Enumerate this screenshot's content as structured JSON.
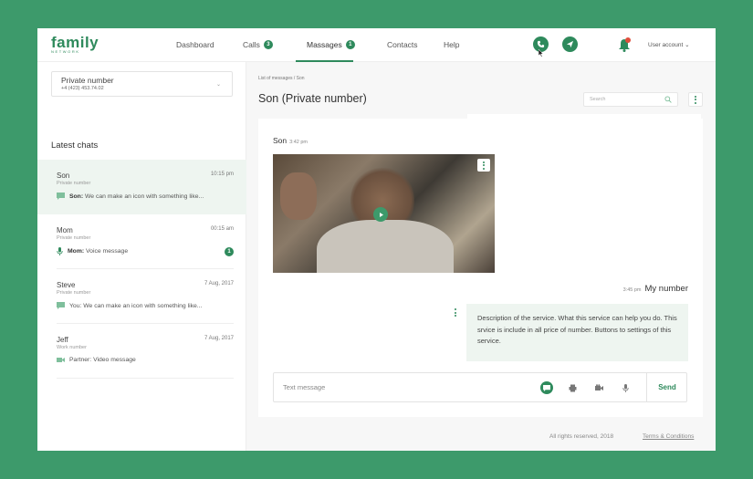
{
  "logo": {
    "main": "family",
    "sub": "NETWORK"
  },
  "nav": [
    {
      "label": "Dashboard",
      "badge": ""
    },
    {
      "label": "Calls",
      "badge": "3"
    },
    {
      "label": "Massages",
      "badge": "1"
    },
    {
      "label": "Contacts",
      "badge": ""
    },
    {
      "label": "Help",
      "badge": ""
    }
  ],
  "nav_active": "Massages",
  "user": {
    "account_label": "User account ⌄"
  },
  "sidebar": {
    "number_select": {
      "title": "Private number",
      "number": "+4 (423) 453.74.02",
      "chevron": "⌄"
    },
    "latest_label": "Latest chats",
    "chats": [
      {
        "name": "Son",
        "type": "Private number",
        "time": "10:15 pm",
        "preview_icon": "chat-icon",
        "preview_bold": "Son:",
        "preview": "We can make an icon with something like...",
        "unread": ""
      },
      {
        "name": "Mom",
        "type": "Private number",
        "time": "00:15 am",
        "preview_icon": "microphone-icon",
        "preview_bold": "Mom:",
        "preview": "Voice message",
        "unread": "1"
      },
      {
        "name": "Steve",
        "type": "Private number",
        "time": "7 Aug, 2017",
        "preview_icon": "chat-icon",
        "preview_bold": "",
        "preview": "You: We can make an icon with something like...",
        "unread": ""
      },
      {
        "name": "Jeff",
        "type": "Work number",
        "time": "7 Aug, 2017",
        "preview_icon": "video-icon",
        "preview_bold": "",
        "preview": "Partner: Video message",
        "unread": ""
      }
    ]
  },
  "main": {
    "breadcrumb": "List of messages / Son",
    "title": "Son (Private number)",
    "search_placeholder": "Search",
    "messages": {
      "incoming": {
        "sender": "Son",
        "time": "3:42 pm"
      },
      "outgoing": {
        "sender": "My number",
        "time": "3:45 pm",
        "text": "Description of the service. What this service can help you do. This srvice is include in all price of number.  Buttons to settings of this service."
      }
    },
    "composer": {
      "placeholder": "Text message",
      "send_label": "Send"
    }
  },
  "footer": {
    "rights": "All rights reserved, 2018",
    "terms": "Terms & Conditions"
  },
  "colors": {
    "accent": "#2e8a5c",
    "background": "#3d9a6b",
    "active_chat": "#eef5f0",
    "notification": "#e04e3c"
  }
}
